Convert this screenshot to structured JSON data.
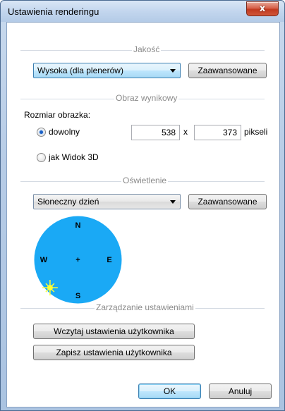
{
  "window": {
    "title": "Ustawienia renderingu",
    "close_symbol": "x"
  },
  "quality": {
    "group_title": "Jakość",
    "preset_value": "Wysoka (dla plenerów)",
    "advanced_label": "Zaawansowane"
  },
  "output": {
    "group_title": "Obraz wynikowy",
    "size_label": "Rozmiar obrazka:",
    "custom_option_label": "dowolny",
    "custom_option_selected": true,
    "width_value": "538",
    "times_symbol": "x",
    "height_value": "373",
    "unit_label": "pikseli",
    "view3d_option_label": "jak Widok 3D",
    "view3d_option_selected": false
  },
  "lighting": {
    "group_title": "Oświetlenie",
    "preset_value": "Słoneczny dzień",
    "advanced_label": "Zaawansowane",
    "compass": {
      "north": "N",
      "south": "S",
      "east": "E",
      "west": "W",
      "center": "+",
      "sun_azimuth_deg": 225,
      "disc_color": "#1aa9f5",
      "sun_color": "#ffff33"
    }
  },
  "settings": {
    "group_title": "Zarządzanie ustawieniami",
    "load_label": "Wczytaj ustawienia użytkownika",
    "save_label": "Zapisz ustawienia użytkownika"
  },
  "footer": {
    "ok_label": "OK",
    "cancel_label": "Anuluj"
  }
}
